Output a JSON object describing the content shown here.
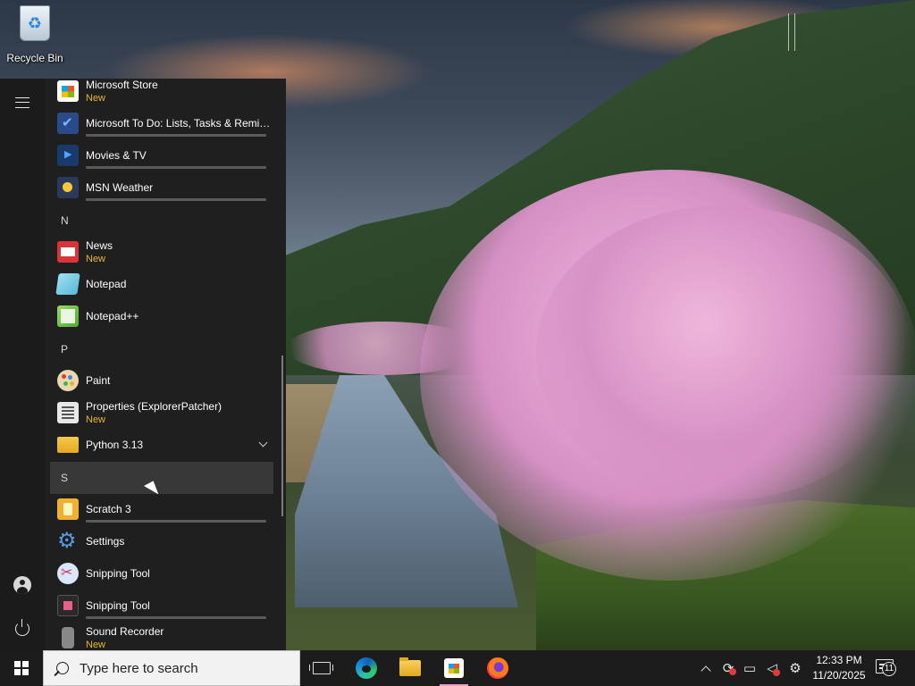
{
  "desktop": {
    "icons": [
      {
        "label": "Recycle Bin",
        "icon": "recycle-bin-icon"
      }
    ]
  },
  "start_menu": {
    "rail": {
      "menu_icon": "hamburger-icon",
      "account_icon": "user-icon",
      "power_icon": "power-icon"
    },
    "items": [
      {
        "type": "app",
        "name": "Microsoft Store",
        "badge": "New",
        "icon": "microsoft-store-icon"
      },
      {
        "type": "app",
        "name": "Microsoft To Do: Lists, Tasks & Remin...",
        "icon": "todo-icon"
      },
      {
        "type": "app",
        "name": "Movies & TV",
        "icon": "movies-tv-icon"
      },
      {
        "type": "app",
        "name": "MSN Weather",
        "icon": "weather-icon"
      },
      {
        "type": "header",
        "letter": "N"
      },
      {
        "type": "app",
        "name": "News",
        "badge": "New",
        "icon": "news-icon"
      },
      {
        "type": "app",
        "name": "Notepad",
        "icon": "notepad-icon"
      },
      {
        "type": "app",
        "name": "Notepad++",
        "icon": "notepadpp-icon"
      },
      {
        "type": "header",
        "letter": "P"
      },
      {
        "type": "app",
        "name": "Paint",
        "icon": "paint-icon"
      },
      {
        "type": "app",
        "name": "Properties (ExplorerPatcher)",
        "badge": "New",
        "icon": "properties-icon"
      },
      {
        "type": "folder",
        "name": "Python 3.13",
        "icon": "folder-icon"
      },
      {
        "type": "header",
        "letter": "S"
      },
      {
        "type": "app",
        "name": "Scratch 3",
        "icon": "scratch-icon"
      },
      {
        "type": "app",
        "name": "Settings",
        "icon": "settings-icon"
      },
      {
        "type": "app",
        "name": "Snipping Tool",
        "icon": "snipping-tool-icon"
      },
      {
        "type": "app",
        "name": "Snipping Tool",
        "icon": "snipping-tool-legacy-icon"
      },
      {
        "type": "app",
        "name": "Sound Recorder",
        "badge": "New",
        "icon": "sound-recorder-icon"
      }
    ]
  },
  "taskbar": {
    "search_placeholder": "Type here to search",
    "pinned": [
      {
        "name": "Task View",
        "icon": "task-view-icon"
      },
      {
        "name": "Microsoft Edge",
        "icon": "edge-icon"
      },
      {
        "name": "File Explorer",
        "icon": "file-explorer-icon"
      },
      {
        "name": "Microsoft Store",
        "icon": "microsoft-store-icon",
        "active": true
      },
      {
        "name": "Firefox",
        "icon": "firefox-icon"
      }
    ],
    "tray": {
      "time": "12:33 PM",
      "date": "11/20/2025",
      "notification_count": "11"
    }
  }
}
